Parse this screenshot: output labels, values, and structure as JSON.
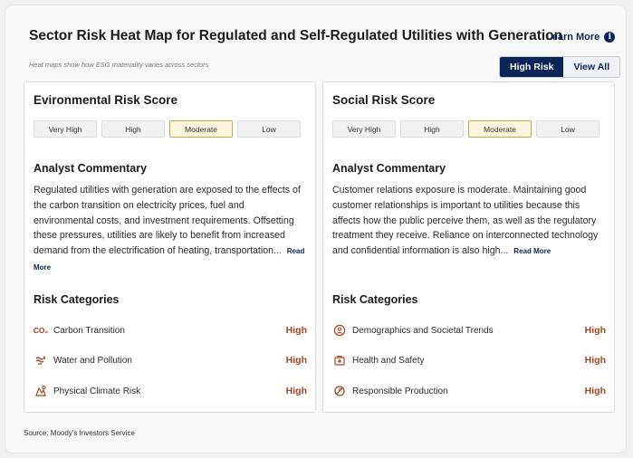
{
  "header": {
    "title": "Sector Risk Heat Map for Regulated and Self-Regulated Utilities with Generation",
    "learn_more": "Learn More",
    "subtitle": "Heat maps show how ESG materiality varies across sectors"
  },
  "toggle": {
    "options": [
      "High Risk",
      "View All"
    ],
    "selected": "High Risk"
  },
  "levels": [
    "Very High",
    "High",
    "Moderate",
    "Low"
  ],
  "cards": {
    "environmental": {
      "title": "Evironmental Risk Score",
      "selected_level": "Moderate",
      "commentary_title": "Analyst Commentary",
      "commentary": "Regulated utilities with generation are exposed to the effects of the carbon transition on electricity prices, fuel and environmental costs, and investment requirements. Offsetting these pressures, utilities are likely to benefit from increased demand from the electrification of heating, transportation...",
      "read_more": "Read More",
      "categories_title": "Risk Categories",
      "categories": [
        {
          "label": "Carbon Transition",
          "icon": "co2-icon",
          "level": "High"
        },
        {
          "label": "Water and Pollution",
          "icon": "water-pollution-icon",
          "level": "High"
        },
        {
          "label": "Physical Climate Risk",
          "icon": "climate-risk-icon",
          "level": "High"
        }
      ]
    },
    "social": {
      "title": "Social Risk Score",
      "selected_level": "Moderate",
      "commentary_title": "Analyst Commentary",
      "commentary": "Customer relations exposure is moderate. Maintaining good customer relationships is important to utilities because this affects how the public perceive them, as well as the regulatory treatment they receive. Reliance on interconnected technology and confidential information is also high...",
      "read_more": "Read More",
      "categories_title": "Risk Categories",
      "categories": [
        {
          "label": "Demographics and Societal Trends",
          "icon": "demographics-icon",
          "level": "High"
        },
        {
          "label": "Health and Safety",
          "icon": "health-safety-icon",
          "level": "High"
        },
        {
          "label": "Responsible Production",
          "icon": "responsible-production-icon",
          "level": "High"
        }
      ]
    }
  },
  "co2_icon_text": "CO₂",
  "source": "Source:  Moody's Investors Service",
  "colors": {
    "navy": "#0b2559",
    "risk_high": "#a5451f",
    "selected_border": "#c4a64d",
    "selected_fill": "#fff6dd"
  }
}
